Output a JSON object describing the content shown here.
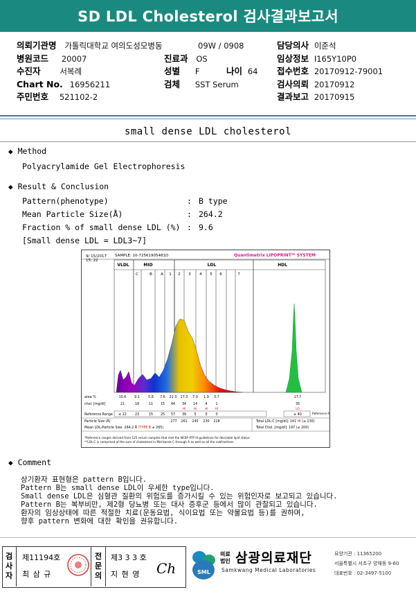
{
  "header": {
    "title": "SD LDL Cholesterol 검사결과보고서"
  },
  "info": {
    "institution_label": "의뢰기관명",
    "institution": "가톨릭대학교 여의도성모병동",
    "ward_value": "09W / 0908",
    "doctor_label": "담당의사",
    "doctor": "이준석",
    "hospital_code_label": "병원코드",
    "hospital_code": "20007",
    "dept_label": "진료과",
    "dept": "OS",
    "clinical_label": "임상정보",
    "clinical": "I165Y10P0",
    "patient_label": "수진자",
    "patient": "서복례",
    "sex_label": "성별",
    "sex": "F",
    "age_label": "나이",
    "age": "64",
    "receipt_label": "접수번호",
    "receipt": "20170912-79001",
    "chart_label": "Chart No.",
    "chart": "16956211",
    "specimen_label": "검체",
    "specimen": "SST Serum",
    "request_label": "검사의뢰",
    "request": "20170912",
    "rrn_label": "주민번호",
    "rrn": "521102-2",
    "report_label": "결과보고",
    "report": "20170915"
  },
  "section_title": "small dense LDL cholesterol",
  "method": {
    "heading": "Method",
    "text": "Polyacrylamide Gel Electrophoresis"
  },
  "result": {
    "heading": "Result & Conclusion",
    "rows": [
      {
        "label": "Pattern(phenotype)",
        "sep": ":",
        "value": "B type"
      },
      {
        "label": "Mean Particle Size(Å)",
        "sep": ":",
        "value": "264.2"
      },
      {
        "label": "Fraction % of small dense LDL (%)",
        "sep": ":",
        "value": "9.6"
      }
    ],
    "note": "[Small dense LDL = LDL3~7]"
  },
  "chart_data": {
    "type": "area",
    "date": "9/ 15/2017",
    "time": "15: 22",
    "sample": "SAMPLE:  10-72561905481D",
    "brand": "Quantimetrix LIPOPRINT",
    "brand_tm": "TM",
    "brand_suffix": " SYSTEM",
    "regions": [
      "VLDL",
      "MID",
      "LDL",
      "HDL"
    ],
    "bands": [
      "C",
      "B",
      "A",
      "1",
      "2",
      "3",
      "4",
      "5",
      "6",
      "7"
    ],
    "area_label": "area %",
    "area_values": [
      "10.6",
      "9.1",
      "5.8",
      "7.6",
      "22.3",
      "17.3",
      "7.0",
      "1.9",
      "0.7",
      "",
      "17.7"
    ],
    "chol_label": "chol. [mg/dl]",
    "chol_values": [
      "21",
      "18",
      "11",
      "15",
      "44",
      "34",
      "14",
      "4",
      "1",
      "",
      "35"
    ],
    "hi_flags": [
      "",
      "",
      "",
      "",
      "",
      "HI",
      "HI",
      "HI",
      "HI",
      "",
      "LO"
    ],
    "ref_label": "Reference Range",
    "ref_values": [
      "≤ 22",
      "23",
      "15",
      "25",
      "57",
      "39",
      "5",
      "0",
      "0",
      "",
      "≥ 40"
    ],
    "ref_label_right": "Reference Range",
    "particle_label": "Particle Size (Å)",
    "particle_values": [
      "277",
      "261",
      "245",
      "230",
      "218"
    ],
    "mean_label": "Mean LDL-Particle Size:",
    "mean_value": "264.2 Å",
    "mean_type": "(TYPE B",
    "mean_ref": "≤ 265)",
    "total_ldl_label": "Total LDL-C [mg/dl]:",
    "total_ldl": "141",
    "total_ldl_flag": "HI",
    "total_ldl_ref": "(≤ 130)",
    "total_chol_label": "Total Chol. [mg/dl]:",
    "total_chol": "197",
    "total_chol_ref": "(≤ 200)",
    "footnote1": "*Reference ranges derived from 125 serum samples that met the NCEP ATP III guidelines for desirable lipid status",
    "footnote2": "**LDL-C is comprised of the sum of cholesterol in Mid bands C through A as well as all the subfractions"
  },
  "comment": {
    "heading": "Comment",
    "lines": [
      "상기환자 표현형은 pattern B입니다.",
      "Pattern B는 small dense LDL이 우세한 type입니다.",
      "Small dense LDL은 심혈관 질환의 위험도를 증가시킬 수 있는 위험인자로 보고되고 있습니다.",
      "Pattern B는 복부비만, 제2형 당뇨병 또는 대사 증후군 등에서 많이 관찰되고 있습니다.",
      "환자의 임상상태에 따른 적절한 치료(운동요법, 식이요법 또는 약물요법 등)를 권하며,",
      "향후 pattern 변화에 대한 확인을 권유합니다."
    ]
  },
  "footer": {
    "tester_label": [
      "검",
      "사",
      "자"
    ],
    "tester_no": "제11194호",
    "tester_name": "최 삼 규",
    "specialist_label": [
      "전",
      "문",
      "의"
    ],
    "specialist_no": "제3 3 3 호",
    "specialist_name": "지 현 영",
    "signature": "Ch",
    "logo_text": "SML",
    "org_prefix1": "의료",
    "org_prefix2": "법인",
    "org_name": "삼광의료재단",
    "org_english": "Samkwang Medical Laboratories",
    "org_code": "요양기관 : 11365200",
    "org_address": "서울특별시 서초구 양재동 9-60",
    "org_phone": "대표번호 : 02-3497-5100"
  }
}
